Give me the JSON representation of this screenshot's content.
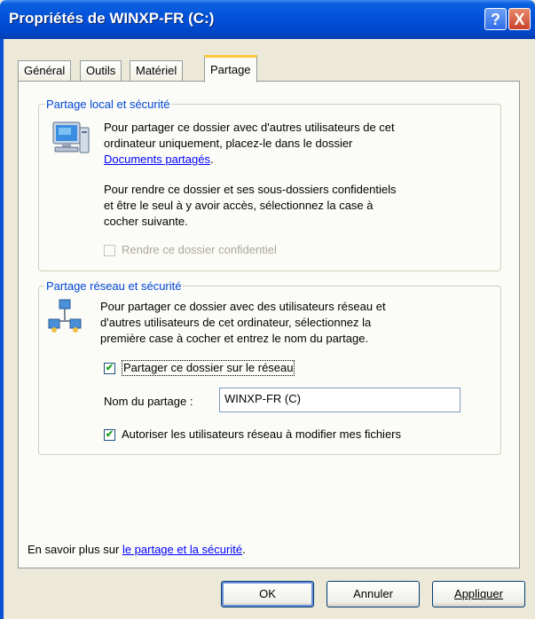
{
  "window": {
    "title": "Propriétés de WINXP-FR (C:)"
  },
  "titlebar_buttons": {
    "help": "?",
    "close": "X"
  },
  "tabs": [
    {
      "label": "Général",
      "active": false
    },
    {
      "label": "Outils",
      "active": false
    },
    {
      "label": "Matériel",
      "active": false
    },
    {
      "label": "Partage",
      "active": true
    }
  ],
  "local_sharing": {
    "legend": "Partage local et sécurité",
    "paragraph1_line1": "Pour partager ce dossier avec d'autres utilisateurs de cet",
    "paragraph1_line2": "ordinateur uniquement, placez-le dans le dossier",
    "shared_docs_link": "Documents partagés",
    "paragraph1_end": ".",
    "paragraph2_line1": "Pour rendre ce dossier et ses sous-dossiers confidentiels",
    "paragraph2_line2": "et être le seul à y avoir accès, sélectionnez la case à",
    "paragraph2_line3": "cocher suivante.",
    "private_checkbox_label": "Rendre ce dossier confidentiel",
    "private_checked": false
  },
  "network_sharing": {
    "legend": "Partage réseau et sécurité",
    "line1": "Pour partager ce dossier avec des utilisateurs réseau et",
    "line2": "d'autres utilisateurs de cet ordinateur, sélectionnez la",
    "line3": "première case à cocher et entrez le nom du partage.",
    "share_checkbox_label": "Partager ce dossier sur le réseau",
    "share_checked": true,
    "share_name_label": "Nom du partage :",
    "share_name_value": "WINXP-FR (C)",
    "allow_modify_label": "Autoriser les utilisateurs réseau à modifier mes fichiers",
    "allow_modify_checked": true
  },
  "learn_more": {
    "prefix": "En savoir plus sur ",
    "link": "le partage et la sécurité",
    "suffix": "."
  },
  "buttons": {
    "ok": "OK",
    "cancel": "Annuler",
    "apply": "Appliquer"
  },
  "check_mark": "✔"
}
